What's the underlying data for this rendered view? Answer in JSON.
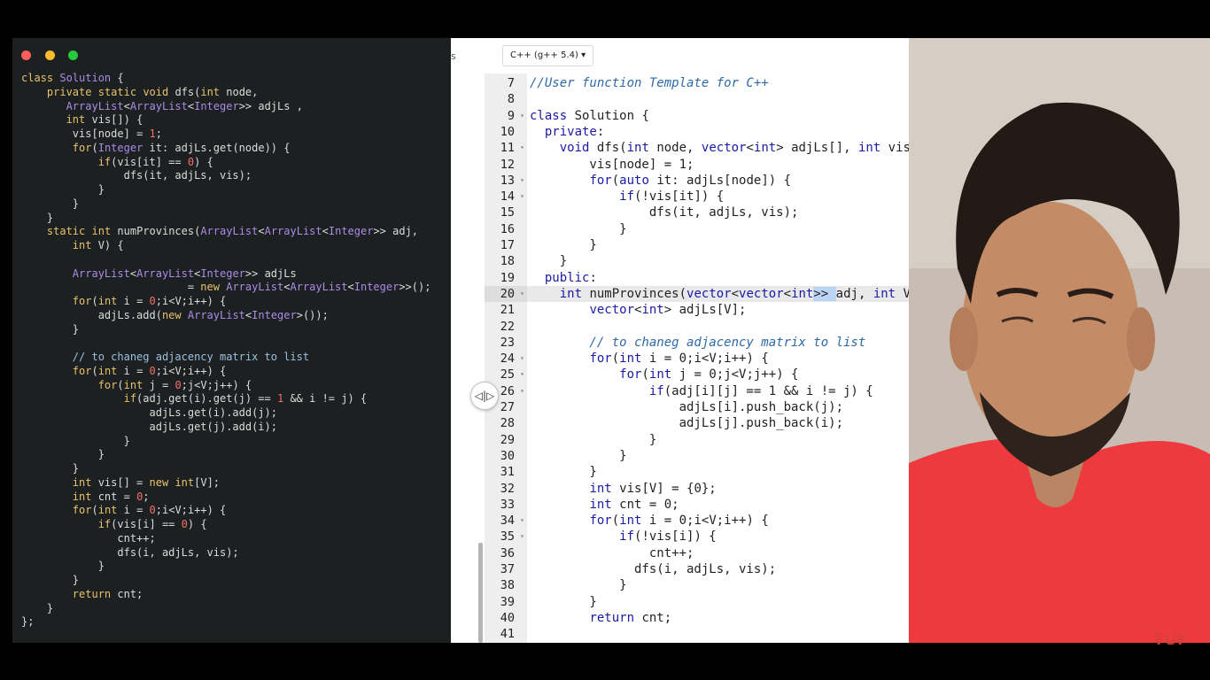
{
  "left_editor": {
    "window_dots": [
      "#ff5f56",
      "#ffbd2e",
      "#27c93f"
    ],
    "lines": [
      "class Solution {",
      "    private static void dfs(int node,",
      "       ArrayList<ArrayList<Integer>> adjLs ,",
      "       int vis[]) {",
      "        vis[node] = 1;",
      "        for(Integer it: adjLs.get(node)) {",
      "            if(vis[it] == 0) {",
      "                dfs(it, adjLs, vis);",
      "            }",
      "        }",
      "    }",
      "    static int numProvinces(ArrayList<ArrayList<Integer>> adj,",
      "        int V) {",
      "",
      "        ArrayList<ArrayList<Integer>> adjLs",
      "                          = new ArrayList<ArrayList<Integer>>();",
      "        for(int i = 0;i<V;i++) {",
      "            adjLs.add(new ArrayList<Integer>());",
      "        }",
      "",
      "        // to chaneg adjacency matrix to list",
      "        for(int i = 0;i<V;i++) {",
      "            for(int j = 0;j<V;j++) {",
      "                if(adj.get(i).get(j) == 1 && i != j) {",
      "                    adjLs.get(i).add(j);",
      "                    adjLs.get(j).add(i);",
      "                }",
      "            }",
      "        }",
      "        int vis[] = new int[V];",
      "        int cnt = 0;",
      "        for(int i = 0;i<V;i++) {",
      "            if(vis[i] == 0) {",
      "               cnt++;",
      "               dfs(i, adjLs, vis);",
      "            }",
      "        }",
      "        return cnt;",
      "    }",
      "};"
    ]
  },
  "middle": {
    "clipped_tab_text": "s",
    "splitter_icon": "split-arrows-icon",
    "splitter_glyph": "◁|▷"
  },
  "right_editor": {
    "language_select": "C++ (g++ 5.4)",
    "dropdown_icon": "chevron-down-icon",
    "dropdown_glyph": "▾",
    "lines": [
      {
        "n": "7",
        "text": "//User function Template for C++",
        "fold": ""
      },
      {
        "n": "8",
        "text": "",
        "fold": ""
      },
      {
        "n": "9",
        "text": "class Solution {",
        "fold": "▾"
      },
      {
        "n": "10",
        "text": "  private:",
        "fold": ""
      },
      {
        "n": "11",
        "text": "    void dfs(int node, vector<int> adjLs[], int vis[]",
        "fold": "▾"
      },
      {
        "n": "12",
        "text": "        vis[node] = 1;",
        "fold": ""
      },
      {
        "n": "13",
        "text": "        for(auto it: adjLs[node]) {",
        "fold": "▾"
      },
      {
        "n": "14",
        "text": "            if(!vis[it]) {",
        "fold": "▾"
      },
      {
        "n": "15",
        "text": "                dfs(it, adjLs, vis);",
        "fold": ""
      },
      {
        "n": "16",
        "text": "            }",
        "fold": ""
      },
      {
        "n": "17",
        "text": "        }",
        "fold": ""
      },
      {
        "n": "18",
        "text": "    }",
        "fold": ""
      },
      {
        "n": "19",
        "text": "  public:",
        "fold": ""
      },
      {
        "n": "20",
        "text": "    int numProvinces(vector<vector<int>> adj, int V) {",
        "fold": "▾"
      },
      {
        "n": "21",
        "text": "        vector<int> adjLs[V];",
        "fold": ""
      },
      {
        "n": "22",
        "text": "",
        "fold": ""
      },
      {
        "n": "23",
        "text": "        // to chaneg adjacency matrix to list",
        "fold": ""
      },
      {
        "n": "24",
        "text": "        for(int i = 0;i<V;i++) {",
        "fold": "▾"
      },
      {
        "n": "25",
        "text": "            for(int j = 0;j<V;j++) {",
        "fold": "▾"
      },
      {
        "n": "26",
        "text": "                if(adj[i][j] == 1 && i != j) {",
        "fold": "▾"
      },
      {
        "n": "27",
        "text": "                    adjLs[i].push_back(j);",
        "fold": ""
      },
      {
        "n": "28",
        "text": "                    adjLs[j].push_back(i);",
        "fold": ""
      },
      {
        "n": "29",
        "text": "                }",
        "fold": ""
      },
      {
        "n": "30",
        "text": "            }",
        "fold": ""
      },
      {
        "n": "31",
        "text": "        }",
        "fold": ""
      },
      {
        "n": "32",
        "text": "        int vis[V] = {0};",
        "fold": ""
      },
      {
        "n": "33",
        "text": "        int cnt = 0;",
        "fold": ""
      },
      {
        "n": "34",
        "text": "        for(int i = 0;i<V;i++) {",
        "fold": "▾"
      },
      {
        "n": "35",
        "text": "            if(!vis[i]) {",
        "fold": "▾"
      },
      {
        "n": "36",
        "text": "                cnt++;",
        "fold": ""
      },
      {
        "n": "37",
        "text": "              dfs(i, adjLs, vis);",
        "fold": ""
      },
      {
        "n": "38",
        "text": "            }",
        "fold": ""
      },
      {
        "n": "39",
        "text": "        }",
        "fold": ""
      },
      {
        "n": "40",
        "text": "        return cnt;",
        "fold": ""
      },
      {
        "n": "41",
        "text": "",
        "fold": ""
      }
    ],
    "active_line": "20"
  },
  "webcam": {
    "watermark": "TUF",
    "shirt_color": "#ee3a3f"
  },
  "colors": {
    "left_bg": "#1d2021",
    "keyword": "#e6c26b",
    "type": "#ab8be8",
    "number": "#f0706a",
    "right_keyword": "#1a1aa6"
  }
}
